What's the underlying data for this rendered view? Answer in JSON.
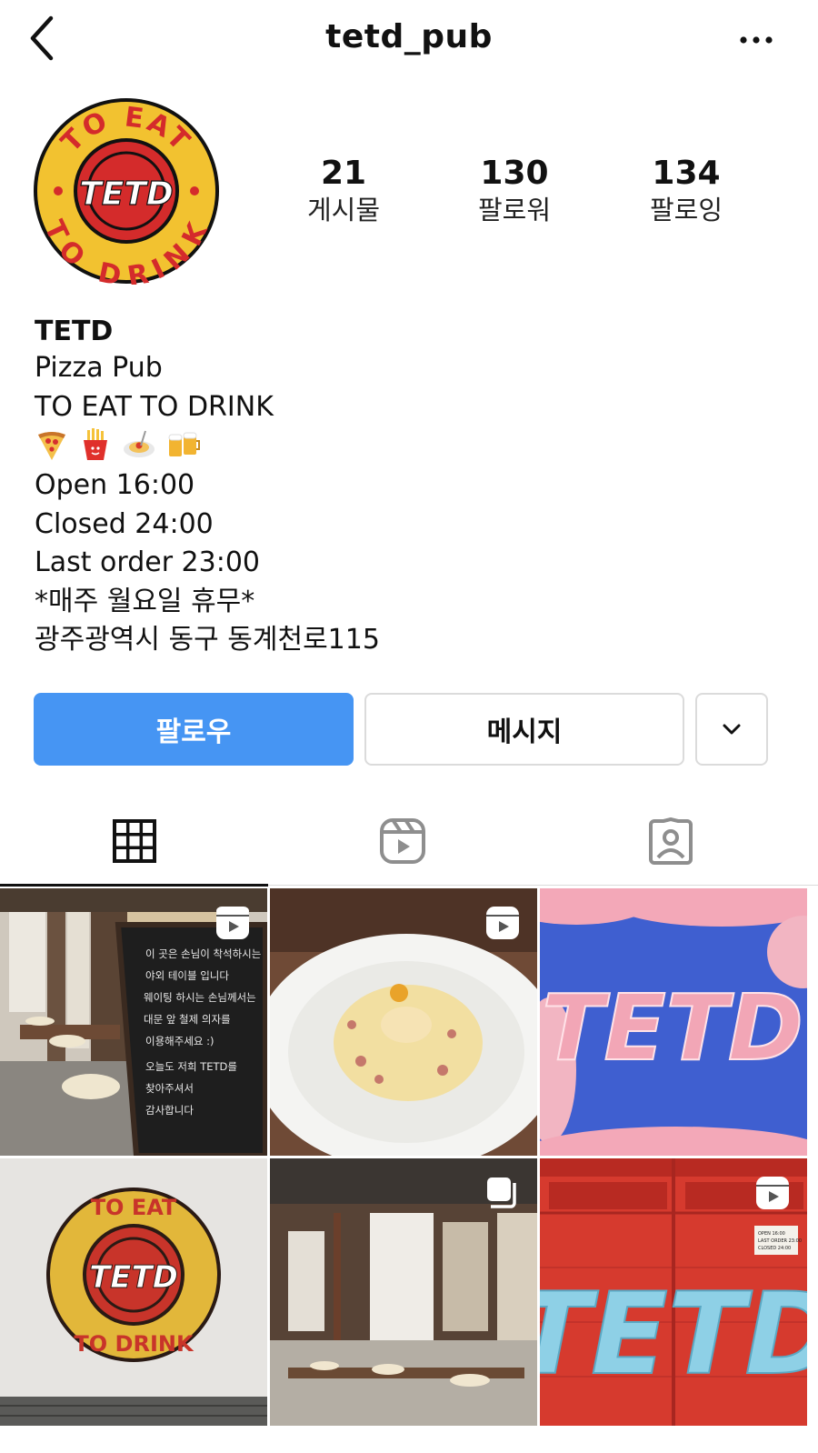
{
  "header": {
    "back_icon": "chevron-left-icon",
    "username": "tetd_pub",
    "more_icon": "more-horizontal-icon"
  },
  "profile": {
    "avatar_logo_text": "TO EAT TO DRINK TETD",
    "stats": [
      {
        "count": "21",
        "label": "게시물"
      },
      {
        "count": "130",
        "label": "팔로워"
      },
      {
        "count": "134",
        "label": "팔로잉"
      }
    ]
  },
  "bio": {
    "name": "TETD",
    "category": "Pizza Pub",
    "tagline": "TO EAT TO DRINK",
    "emojis": [
      "pizza-emoji",
      "fries-emoji",
      "spaghetti-emoji",
      "beer-mugs-emoji"
    ],
    "hours_open": "Open 16:00",
    "hours_closed": "Closed 24:00",
    "last_order": "Last order 23:00",
    "holiday": "*매주 월요일 휴무*",
    "address": "광주광역시 동구 동계천로115"
  },
  "actions": {
    "follow": "팔로우",
    "message": "메시지",
    "more_icon": "chevron-down-icon"
  },
  "tabs": [
    {
      "name": "posts",
      "icon": "grid-icon",
      "active": true
    },
    {
      "name": "reels",
      "icon": "reels-icon",
      "active": false
    },
    {
      "name": "tagged",
      "icon": "tagged-user-icon",
      "active": false
    }
  ],
  "posts": [
    {
      "subject": "outdoor bench with chalkboard sign",
      "badge": "reels-icon",
      "chalkboard_lines": [
        "이 곳은 손님이 착석하시는",
        "야외 테이블 입니다",
        "웨이팅 하시는 손님께서는",
        "대문 앞 철제 의자를",
        "이용해주세요 :)",
        "오늘도 저희 TETD를",
        "찾아주셔서",
        "감사합니다"
      ]
    },
    {
      "subject": "carbonara pasta",
      "badge": "reels-icon"
    },
    {
      "subject": "TETD logo on sky",
      "badge": null,
      "logo_text": "TETD"
    },
    {
      "subject": "TETD wall logo",
      "badge": null,
      "logo_text": "TO EAT TO DRINK TETD"
    },
    {
      "subject": "hanok courtyard benches",
      "badge": "carousel-icon"
    },
    {
      "subject": "TETD on red gate",
      "badge": "reels-icon",
      "logo_text": "TETD",
      "sign_text": [
        "OPEN 16:00",
        "LAST ORDER 23:00",
        "CLOSED 24:00"
      ]
    }
  ],
  "colors": {
    "follow_button": "#4695f3",
    "border": "#dbdbdb",
    "logo_red": "#d42b2b",
    "logo_yellow": "#f2c230"
  }
}
